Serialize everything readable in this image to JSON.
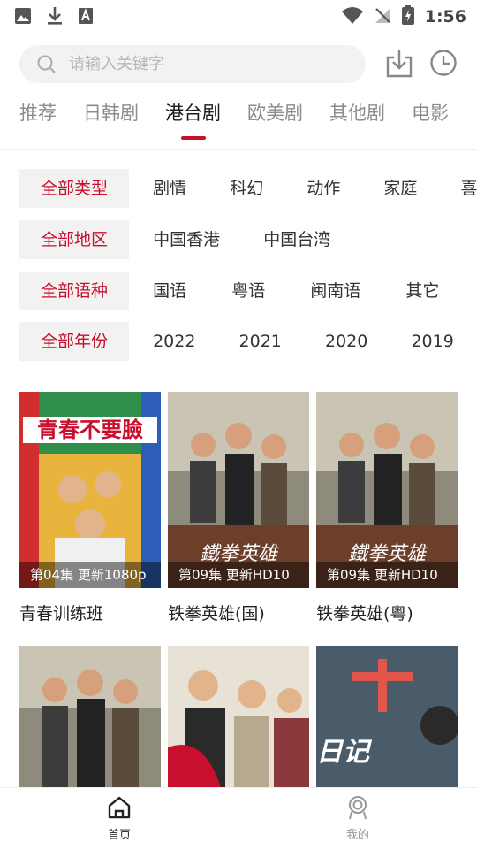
{
  "status_bar": {
    "time": "1:56",
    "left_icons": [
      "image-icon",
      "download-icon",
      "text-icon"
    ],
    "right_icons": [
      "wifi-icon",
      "no-signal-icon",
      "battery-charging-icon"
    ]
  },
  "search": {
    "placeholder": "请输入关键字",
    "value": ""
  },
  "header_icons": [
    "download-box-icon",
    "history-clock-icon"
  ],
  "tabs": [
    {
      "label": "推荐",
      "active": false
    },
    {
      "label": "日韩剧",
      "active": false
    },
    {
      "label": "港台剧",
      "active": true
    },
    {
      "label": "欧美剧",
      "active": false
    },
    {
      "label": "其他剧",
      "active": false
    },
    {
      "label": "电影",
      "active": false
    }
  ],
  "filters": {
    "genre": {
      "selected": "全部类型",
      "options": [
        "剧情",
        "科幻",
        "动作",
        "家庭",
        "喜"
      ]
    },
    "region": {
      "selected": "全部地区",
      "options": [
        "中国香港",
        "中国台湾"
      ]
    },
    "language": {
      "selected": "全部语种",
      "options": [
        "国语",
        "粤语",
        "闽南语",
        "其它"
      ]
    },
    "year": {
      "selected": "全部年份",
      "options": [
        "2022",
        "2021",
        "2020",
        "2019"
      ]
    }
  },
  "shows": [
    {
      "title": "青春训练班",
      "badge": "第04集 更新1080p",
      "poster_text": "青春不要臉"
    },
    {
      "title": "铁拳英雄(国)",
      "badge": "第09集 更新HD10",
      "poster_text": "鐵拳英雄"
    },
    {
      "title": "铁拳英雄(粤)",
      "badge": "第09集 更新HD10",
      "poster_text": "鐵拳英雄"
    },
    {
      "title": "",
      "badge": "",
      "poster_text": ""
    },
    {
      "title": "",
      "badge": "",
      "poster_text": ""
    },
    {
      "title": "",
      "badge": "",
      "poster_text": "日记"
    }
  ],
  "bottom_nav": [
    {
      "label": "首页",
      "icon": "home-icon",
      "active": true
    },
    {
      "label": "我的",
      "icon": "profile-icon",
      "active": false
    }
  ],
  "colors": {
    "accent": "#c8102e",
    "inactive_tab": "#8c8c8c",
    "filter_bg": "#f2f2f2"
  }
}
